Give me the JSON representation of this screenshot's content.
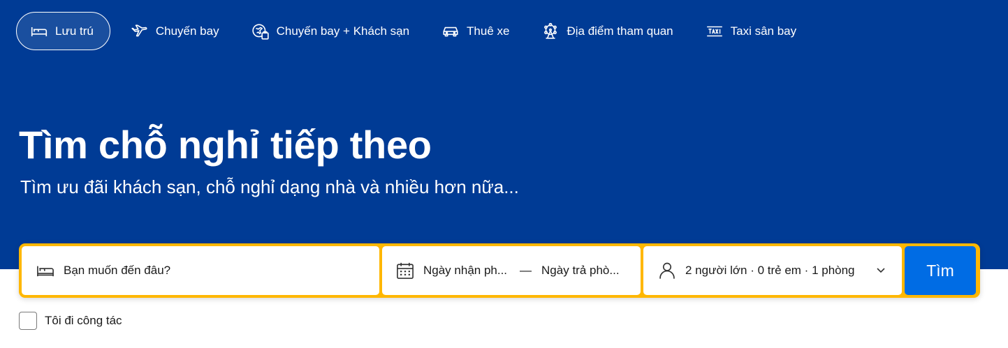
{
  "nav": {
    "items": [
      {
        "label": "Lưu trú",
        "icon": "bed-icon",
        "active": true
      },
      {
        "label": "Chuyến bay",
        "icon": "plane-icon",
        "active": false
      },
      {
        "label": "Chuyến bay + Khách sạn",
        "icon": "flight-hotel-icon",
        "active": false
      },
      {
        "label": "Thuê xe",
        "icon": "car-icon",
        "active": false
      },
      {
        "label": "Địa điểm tham quan",
        "icon": "ferris-wheel-icon",
        "active": false
      },
      {
        "label": "Taxi sân bay",
        "icon": "taxi-icon",
        "active": false
      }
    ]
  },
  "hero": {
    "title": "Tìm chỗ nghỉ tiếp theo",
    "subtitle": "Tìm ưu đãi khách sạn, chỗ nghỉ dạng nhà và nhiều hơn nữa..."
  },
  "search": {
    "destination_placeholder": "Bạn muốn đến đâu?",
    "checkin_placeholder": "Ngày nhận ph...",
    "date_separator": "—",
    "checkout_placeholder": "Ngày trả phò...",
    "guests": "2 người lớn · 0 trẻ em · 1 phòng",
    "button_label": "Tìm"
  },
  "business_trip": {
    "label": "Tôi đi công tác",
    "checked": false
  },
  "colors": {
    "hero_bg": "#003b95",
    "search_border": "#ffb700",
    "search_button": "#006ce4"
  }
}
